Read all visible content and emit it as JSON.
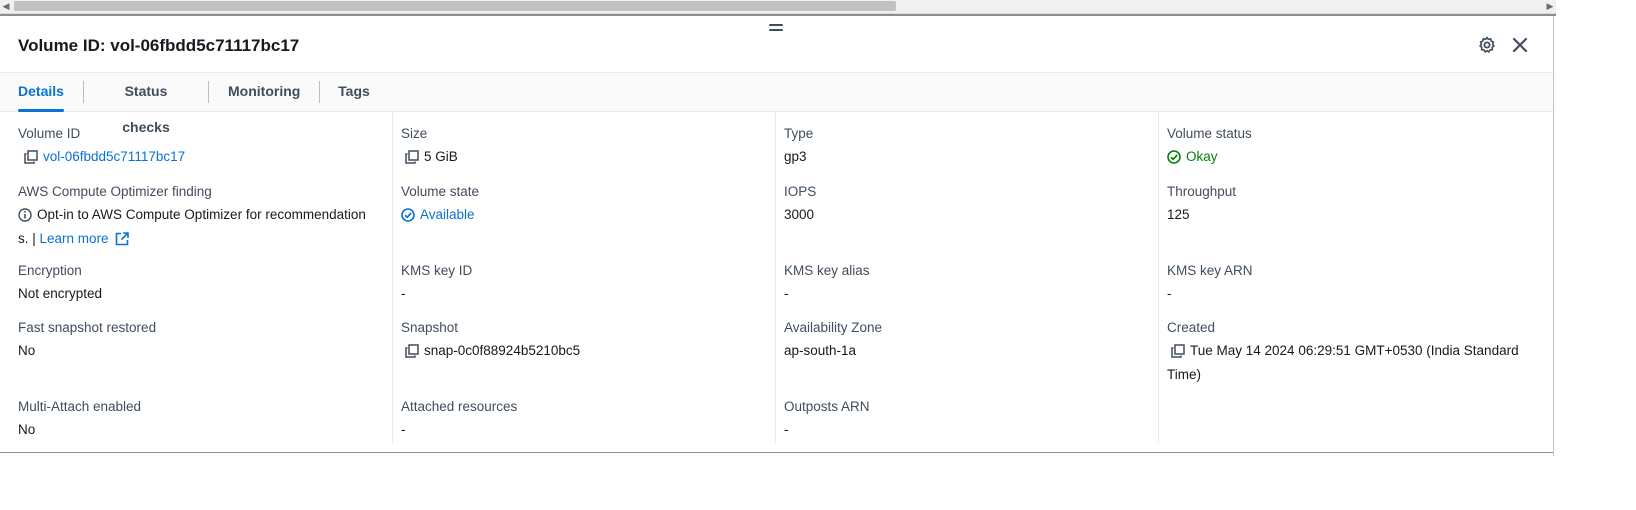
{
  "panel": {
    "title": "Volume ID: vol-06fbdd5c71117bc17",
    "tabs": [
      {
        "label": "Details",
        "active": true
      },
      {
        "label": "Status checks",
        "active": false
      },
      {
        "label": "Monitoring",
        "active": false
      },
      {
        "label": "Tags",
        "active": false
      }
    ]
  },
  "details": {
    "volume_id": {
      "label": "Volume ID",
      "value": "vol-06fbdd5c71117bc17"
    },
    "size": {
      "label": "Size",
      "value": "5 GiB"
    },
    "type": {
      "label": "Type",
      "value": "gp3"
    },
    "volume_status": {
      "label": "Volume status",
      "value": "Okay"
    },
    "optimizer": {
      "label": "AWS Compute Optimizer finding",
      "value_line1": "Opt-in to AWS Compute Optimizer for recommendation",
      "value_line2": "s. |",
      "link": "Learn more"
    },
    "volume_state": {
      "label": "Volume state",
      "value": "Available"
    },
    "iops": {
      "label": "IOPS",
      "value": "3000"
    },
    "throughput": {
      "label": "Throughput",
      "value": "125"
    },
    "encryption": {
      "label": "Encryption",
      "value": "Not encrypted"
    },
    "kms_key_id": {
      "label": "KMS key ID",
      "value": "-"
    },
    "kms_key_alias": {
      "label": "KMS key alias",
      "value": "-"
    },
    "kms_key_arn": {
      "label": "KMS key ARN",
      "value": "-"
    },
    "fast_snapshot": {
      "label": "Fast snapshot restored",
      "value": "No"
    },
    "snapshot": {
      "label": "Snapshot",
      "value": "snap-0c0f88924b5210bc5"
    },
    "availability_zone": {
      "label": "Availability Zone",
      "value": "ap-south-1a"
    },
    "created": {
      "label": "Created",
      "value_line1": "Tue May 14 2024 06:29:51 GMT+0530 (India Standard",
      "value_line2": "Time)"
    },
    "multi_attach": {
      "label": "Multi-Attach enabled",
      "value": "No"
    },
    "attached_resources": {
      "label": "Attached resources",
      "value": "-"
    },
    "outposts_arn": {
      "label": "Outposts ARN",
      "value": "-"
    }
  },
  "colors": {
    "link": "#0972d3",
    "success": "#037f0c",
    "text": "#16191f",
    "label": "#414d5c"
  },
  "icons": [
    "settings-gear-icon",
    "close-icon",
    "copy-icon",
    "status-positive-icon",
    "status-info-icon",
    "info-icon",
    "external-link-icon"
  ]
}
